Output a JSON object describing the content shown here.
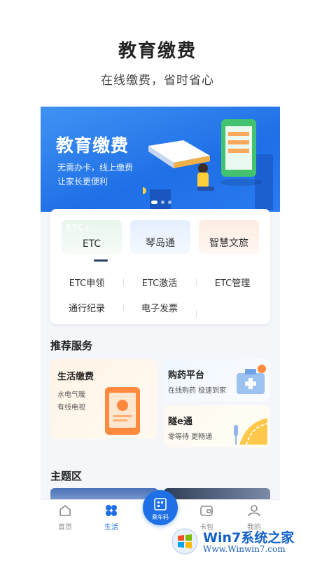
{
  "header": {
    "title": "教育缴费",
    "subtitle": "在线缴费，省时省心"
  },
  "banner": {
    "title": "教育缴费",
    "line1": "无需办卡，线上缴费",
    "line2": "让家长更便利"
  },
  "tabs": [
    {
      "label": "ETC",
      "ghost": "ETC+"
    },
    {
      "label": "琴岛通",
      "ghost": ""
    },
    {
      "label": "智慧文旅",
      "ghost": ""
    }
  ],
  "grid": {
    "row1": [
      "ETC申领",
      "ETC激活",
      "ETC管理"
    ],
    "row2": [
      "通行纪录",
      "电子发票"
    ]
  },
  "recommend": {
    "title": "推荐服务",
    "left": {
      "title": "生活缴费",
      "desc1": "水电气暖",
      "desc2": "有线电视"
    },
    "right_top": {
      "title": "购药平台",
      "desc": "在线购药 极速到家"
    },
    "right_bottom": {
      "title": "隧e通",
      "desc": "零等待 更畅通"
    }
  },
  "theme": {
    "title": "主题区"
  },
  "tabbar": {
    "home": "首页",
    "life": "生活",
    "center": "乘车码",
    "wallet": "卡包",
    "mine": "我的"
  },
  "watermark": {
    "brand": "Win7系统之家",
    "url": "Www.Winwin7.com"
  },
  "colors": {
    "accent": "#1f6fe6",
    "banner": "#2a7cf0",
    "active_tab_text": "#1f6fe6"
  }
}
